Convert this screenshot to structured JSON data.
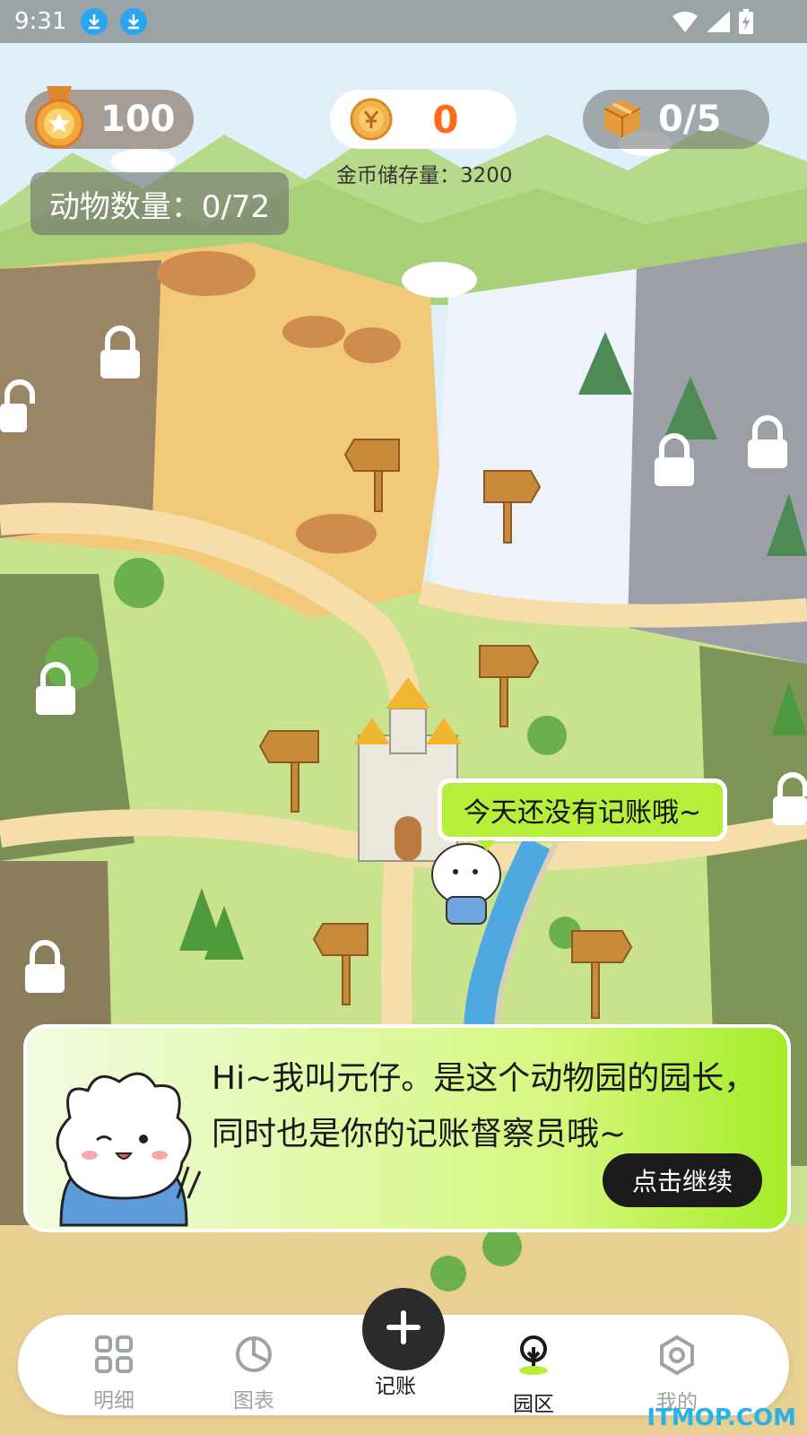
{
  "status_bar": {
    "time": "9:31"
  },
  "top_stats": {
    "level_value": "100",
    "coins_value": "0",
    "box_value": "0/5",
    "storage_label": "金币储存量：3200"
  },
  "animal_count": "动物数量：0/72",
  "speech_bubble": "今天还没有记账哦~",
  "intro": {
    "line1": "Hi~我叫元仔。是这个动物园的园长，",
    "line2": "同时也是你的记账督察员哦~",
    "continue_label": "点击继续"
  },
  "nav": {
    "items": [
      {
        "label": "明细"
      },
      {
        "label": "图表"
      },
      {
        "label": "记账"
      },
      {
        "label": "园区"
      },
      {
        "label": "我的"
      }
    ],
    "active": "园区"
  },
  "watermark": "ITMOP.COM",
  "colors": {
    "accent_green": "#b5ef39",
    "coin_orange": "#ff6a1a",
    "dark_button": "#1b1b1b"
  }
}
